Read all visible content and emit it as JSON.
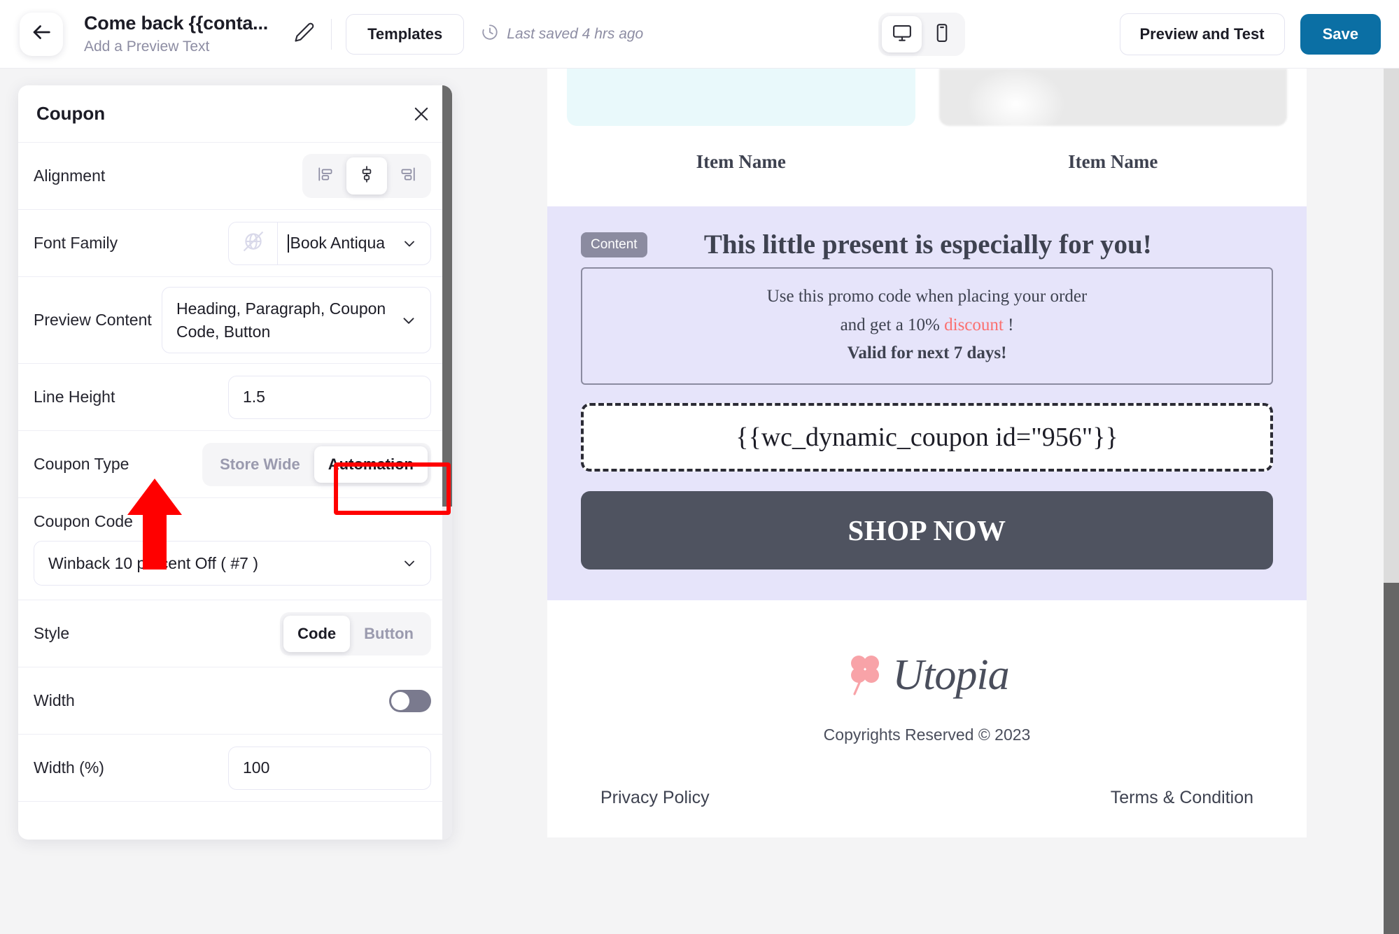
{
  "topbar": {
    "back_icon": "arrow-left-icon",
    "title": "Come back {{conta...",
    "subtitle": "Add a Preview Text",
    "pencil_icon": "pencil-icon",
    "templates_label": "Templates",
    "clock_icon": "clock-icon",
    "last_saved": "Last saved 4 hrs ago",
    "desktop_icon": "desktop-icon",
    "mobile_icon": "mobile-icon",
    "preview_label": "Preview and Test",
    "save_label": "Save",
    "save_color": "#0b6fa4"
  },
  "panel": {
    "title": "Coupon",
    "close_icon": "close-icon",
    "alignment": {
      "label": "Alignment",
      "options": [
        "align-left-icon",
        "align-center-icon",
        "align-right-icon"
      ],
      "selected": "align-center-icon"
    },
    "font_family": {
      "label": "Font Family",
      "globe_icon": "globe-disabled-icon",
      "value": "Book Antiqua",
      "chevron_icon": "chevron-down-icon"
    },
    "preview_content": {
      "label": "Preview Content",
      "value": "Heading, Paragraph, Coupon Code, Button",
      "chevron_icon": "chevron-down-icon"
    },
    "line_height": {
      "label": "Line Height",
      "value": "1.5"
    },
    "coupon_type": {
      "label": "Coupon Type",
      "options": [
        "Store Wide",
        "Automation"
      ],
      "selected": "Automation"
    },
    "coupon_code": {
      "label": "Coupon Code",
      "value": "Winback 10 percent Off ( #7 )",
      "chevron_icon": "chevron-down-icon"
    },
    "style": {
      "label": "Style",
      "options": [
        "Code",
        "Button"
      ],
      "selected": "Code"
    },
    "width_toggle": {
      "label": "Width",
      "state": "off"
    },
    "width_percent": {
      "label": "Width (%)",
      "value": "100"
    },
    "annotation": {
      "highlight_color": "#ff0000",
      "arrow_color": "#ff0000"
    }
  },
  "email": {
    "products": [
      {
        "name": "Item Name",
        "image": "product-placeholder-mint"
      },
      {
        "name": "Item Name",
        "image": "product-photo-cotton"
      }
    ],
    "coupon_block": {
      "badge": "Content",
      "heading": "This little present is especially for you!",
      "promo_line1": "Use this promo code when placing your order",
      "promo_line2_prefix": "and get a 10% ",
      "promo_line2_highlight": "discount",
      "promo_line2_suffix": " !",
      "promo_line3": "Valid for next 7 days!",
      "highlight_color": "#fb6f6f",
      "background": "#e6e4fa",
      "coupon_code": "{{wc_dynamic_coupon id=\"956\"}}",
      "cta_label": "SHOP NOW",
      "cta_color": "#4f5360"
    },
    "footer": {
      "logo_icon": "clover-icon",
      "brand": "Utopia",
      "copyright": "Copyrights Reserved © 2023",
      "links": [
        "Privacy Policy",
        "Terms & Condition"
      ]
    }
  }
}
